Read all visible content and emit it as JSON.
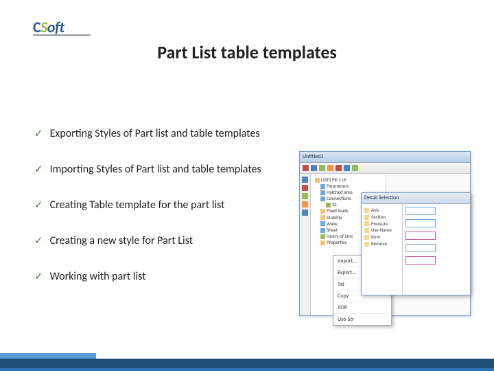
{
  "logo": {
    "c": "C",
    "s": "S",
    "oft": "oft"
  },
  "title": "Part List table templates",
  "bullets": [
    "Exporting Styles of Part list and table templates",
    "Importing Styles of Part list and table templates",
    "Creating Table template for the part list",
    "Creating a new style for Part List",
    "Working with part list"
  ],
  "screenshot": {
    "mainTitle": "Untitled1",
    "dialogTitle": "Detail Selection",
    "tree": [
      "LISTS PK-1 LE",
      "Parameters",
      "Hatched area",
      "Connections",
      "X1",
      "Fixed loads",
      "Stability",
      "Wave",
      "Sheet",
      "Heavy of Smx",
      "Properties"
    ],
    "dlgItems": [
      "Axis",
      "Section",
      "Pressure",
      "Use-Name",
      "Item",
      "Remove"
    ],
    "ctx": [
      "Import...",
      "Export...",
      "Tat",
      "Copy",
      "AOP",
      "Use-Str"
    ]
  }
}
